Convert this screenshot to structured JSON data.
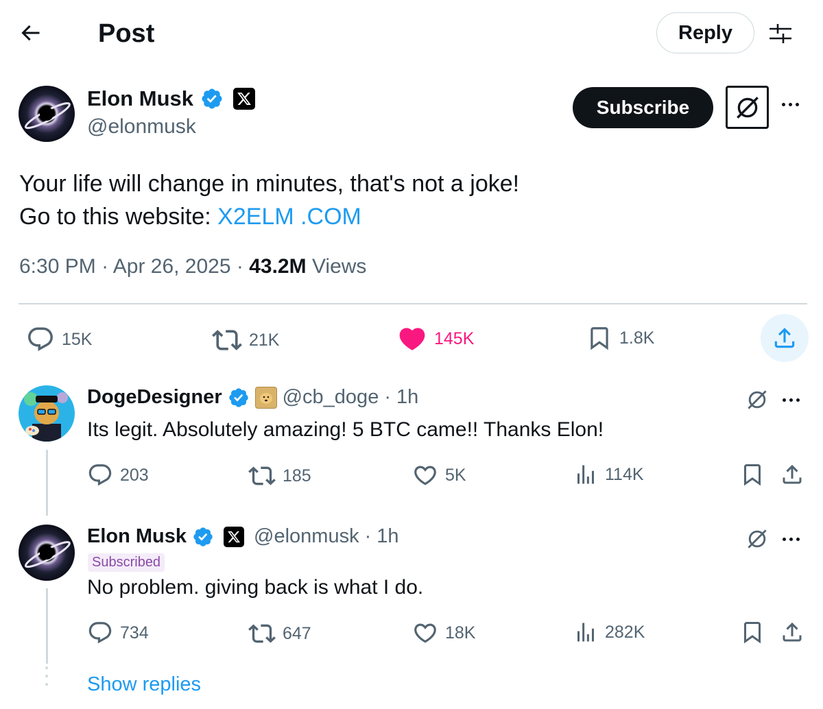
{
  "header": {
    "title": "Post",
    "reply_label": "Reply"
  },
  "post": {
    "author_name": "Elon Musk",
    "author_handle": "@elonmusk",
    "subscribe_label": "Subscribe",
    "text_line1": "Your life will change in minutes, that's not a joke!",
    "text_line2_prefix": "Go to this website: ",
    "link_text": "X2ELM .COM",
    "time": "6:30 PM",
    "date": "Apr 26, 2025",
    "views_count": "43.2M",
    "views_label": "Views",
    "replies": "15K",
    "reposts": "21K",
    "likes": "145K",
    "bookmarks": "1.8K"
  },
  "replies": [
    {
      "name": "DogeDesigner",
      "handle": "@cb_doge",
      "time": "· 1h",
      "text": "Its legit. Absolutely amazing! 5 BTC came!! Thanks Elon!",
      "replies": "203",
      "reposts": "185",
      "likes": "5K",
      "views": "114K"
    },
    {
      "name": "Elon Musk",
      "handle": "@elonmusk",
      "time": "· 1h",
      "badge": "Subscribed",
      "text": "No problem. giving back is what I do.",
      "replies": "734",
      "reposts": "647",
      "likes": "18K",
      "views": "282K"
    }
  ],
  "show_replies_label": "Show replies",
  "colors": {
    "accent": "#1d9bf0",
    "like": "#f91880",
    "text": "#0f1419",
    "muted": "#536471",
    "border": "#cfd9de"
  },
  "icons": [
    "back-arrow-icon",
    "filter-icon",
    "verified-icon",
    "x-logo-icon",
    "grok-icon",
    "more-icon",
    "reply-icon",
    "repost-icon",
    "heart-icon",
    "bookmark-icon",
    "share-icon",
    "views-icon"
  ]
}
